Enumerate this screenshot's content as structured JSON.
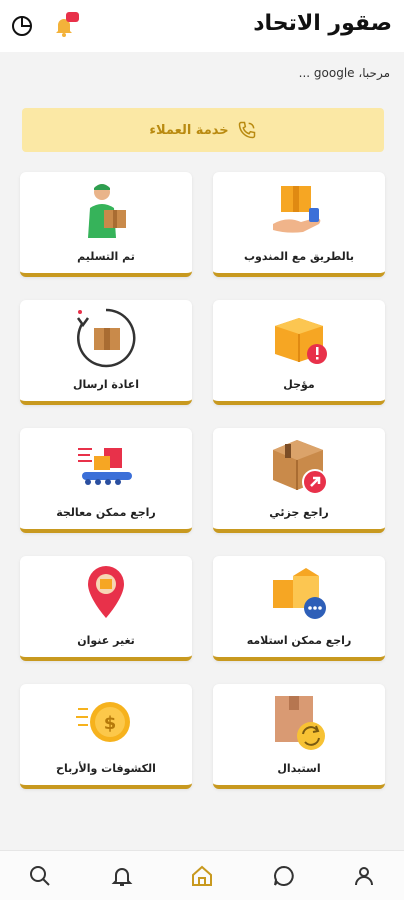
{
  "header": {
    "title": "صقور الاتحاد",
    "icons": [
      "chart-icon",
      "bell-icon",
      "message-badge-icon"
    ]
  },
  "greeting": "مرحبا، google ...",
  "customer_service": {
    "label": "خدمة العملاء",
    "icon": "phone-icon"
  },
  "cards": [
    {
      "id": "with-courier",
      "label": "بالطريق مع المندوب",
      "icon": "hand-package-icon"
    },
    {
      "id": "delivered",
      "label": "تم التسليم",
      "icon": "courier-man-icon"
    },
    {
      "id": "postponed",
      "label": "مؤجل",
      "icon": "box-alert-icon"
    },
    {
      "id": "resend",
      "label": "اعادة ارسال",
      "icon": "box-return-icon"
    },
    {
      "id": "partial-return",
      "label": "راجع جزئي",
      "icon": "box-return-arrow-icon"
    },
    {
      "id": "return-processing",
      "label": "راجع ممكن معالجة",
      "icon": "conveyor-icon"
    },
    {
      "id": "return-receivable",
      "label": "راجع ممكن استلامه",
      "icon": "boxes-more-icon"
    },
    {
      "id": "change-address",
      "label": "تغير عنوان",
      "icon": "location-pin-icon"
    },
    {
      "id": "exchange",
      "label": "استبدال",
      "icon": "box-exchange-icon"
    },
    {
      "id": "statements-profits",
      "label": "الكشوفات والأرباح",
      "icon": "coin-icon"
    }
  ],
  "nav": [
    {
      "id": "search",
      "icon": "search-icon"
    },
    {
      "id": "notifications",
      "icon": "bell-icon"
    },
    {
      "id": "home",
      "icon": "home-icon",
      "active": true
    },
    {
      "id": "chat",
      "icon": "chat-icon"
    },
    {
      "id": "profile",
      "icon": "user-icon"
    }
  ],
  "colors": {
    "accent": "#c8991f",
    "banner_bg": "#fbe8a5",
    "banner_text": "#b98a10",
    "alert": "#e8314a"
  }
}
